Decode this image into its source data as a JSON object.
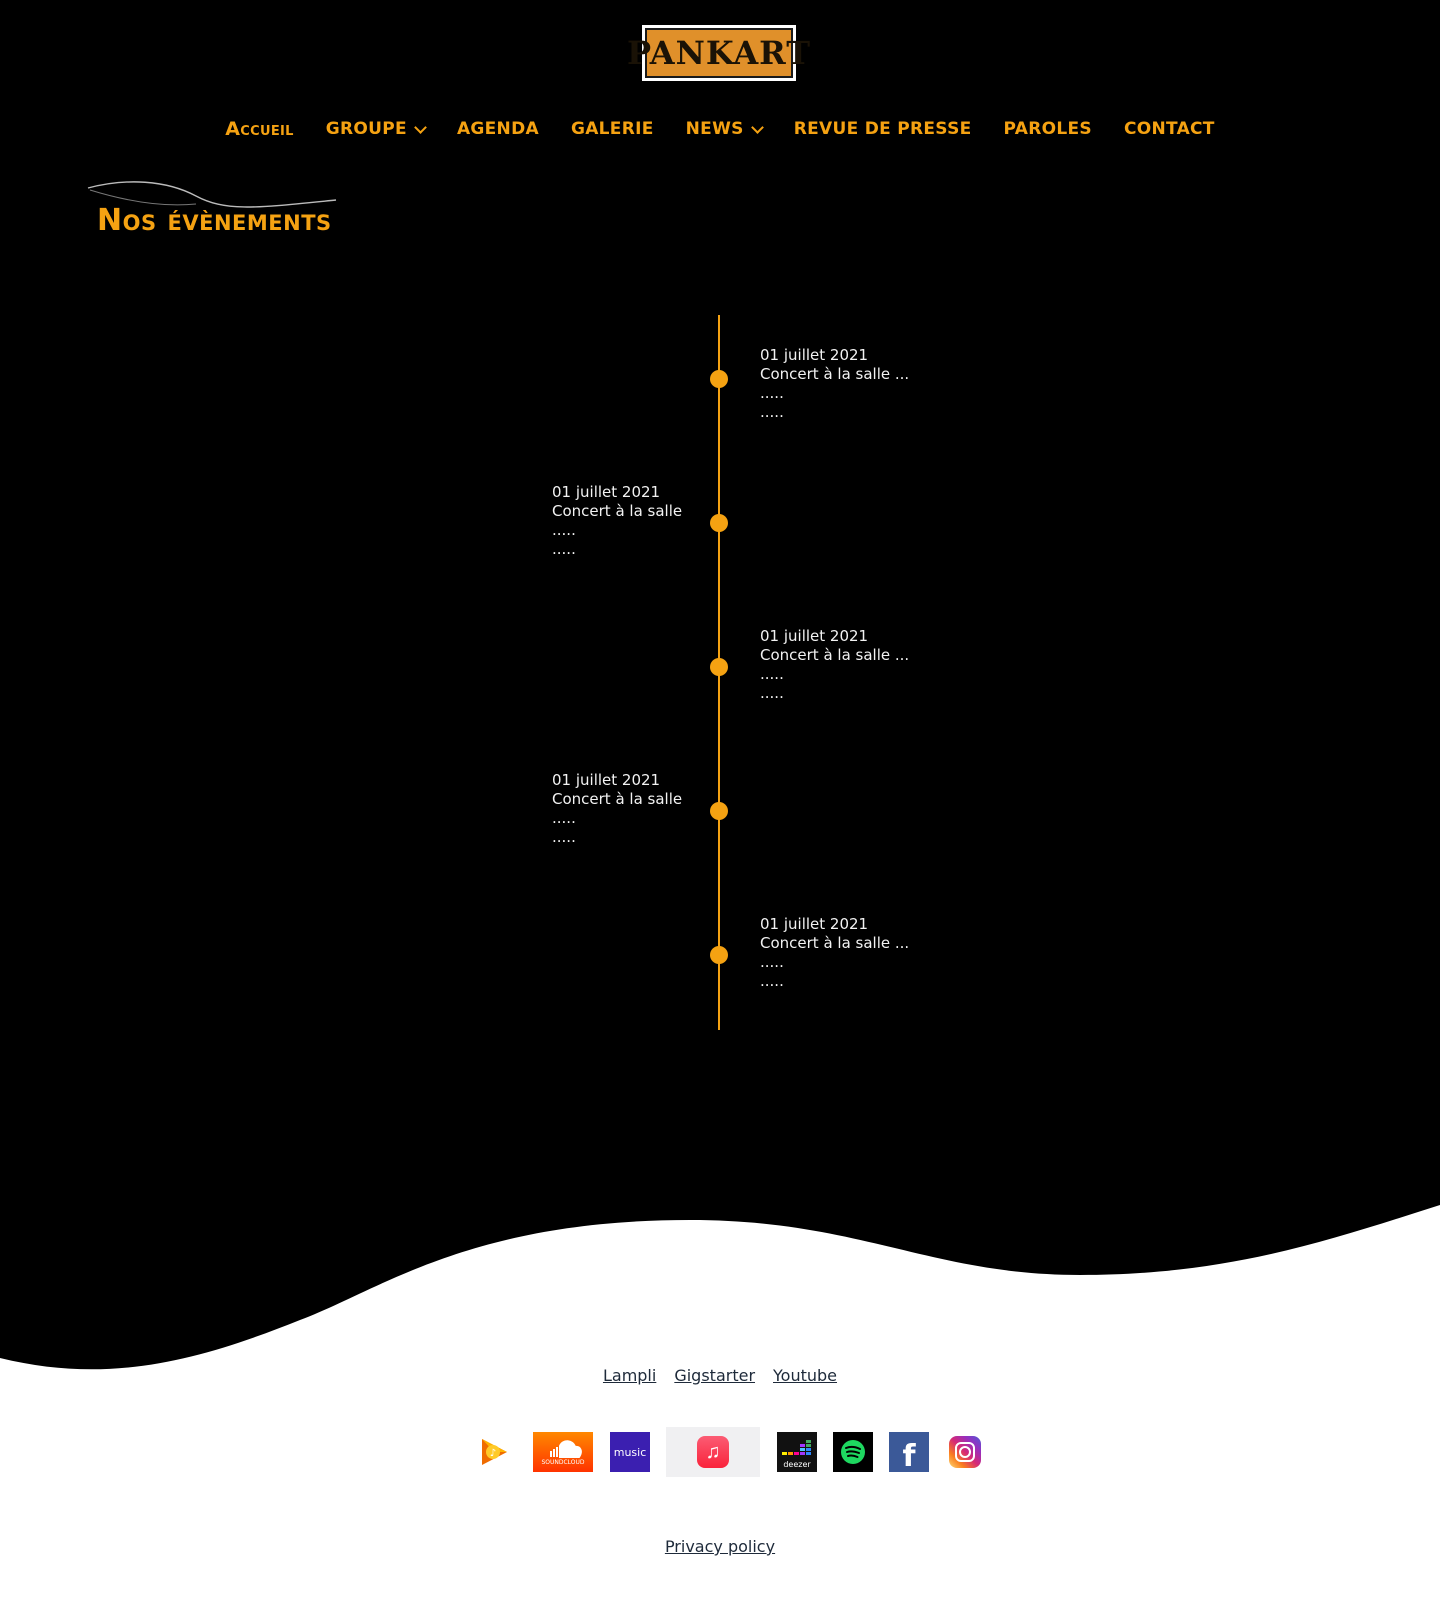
{
  "logo": {
    "text": "PANKART"
  },
  "nav": {
    "items": [
      {
        "label": "Accueil"
      },
      {
        "label": "GROUPE"
      },
      {
        "label": "AGENDA"
      },
      {
        "label": "GALERIE"
      },
      {
        "label": "NEWS"
      },
      {
        "label": "REVUE DE PRESSE"
      },
      {
        "label": "PAROLES"
      },
      {
        "label": "CONTACT"
      }
    ]
  },
  "page": {
    "title": "Nos évènements"
  },
  "events": [
    {
      "date": "01 juillet 2021",
      "title": "Concert à la salle ...",
      "line1": ".....",
      "line2": "....."
    },
    {
      "date": "01 juillet 2021",
      "title": "Concert à la salle",
      "line1": ".....",
      "line2": "....."
    },
    {
      "date": "01 juillet 2021",
      "title": "Concert à la salle ...",
      "line1": ".....",
      "line2": "....."
    },
    {
      "date": "01 juillet 2021",
      "title": "Concert à la salle",
      "line1": ".....",
      "line2": "....."
    },
    {
      "date": "01 juillet 2021",
      "title": "Concert à la salle ...",
      "line1": ".....",
      "line2": "....."
    }
  ],
  "footer": {
    "links": [
      "Lampli",
      "Gigstarter",
      "Youtube"
    ],
    "platforms": [
      {
        "icon": "google-play-music-icon"
      },
      {
        "icon": "soundcloud-icon",
        "label": "SOUNDCLOUD"
      },
      {
        "icon": "amazon-music-icon",
        "label": "music"
      },
      {
        "icon": "apple-music-icon"
      },
      {
        "icon": "deezer-icon",
        "label": "deezer"
      },
      {
        "icon": "spotify-icon"
      },
      {
        "icon": "facebook-icon",
        "label": "f"
      },
      {
        "icon": "instagram-icon"
      }
    ],
    "privacy": "Privacy policy"
  },
  "colors": {
    "accent": "#f5a212",
    "background": "#000000",
    "footer_bg": "#ffffff"
  }
}
